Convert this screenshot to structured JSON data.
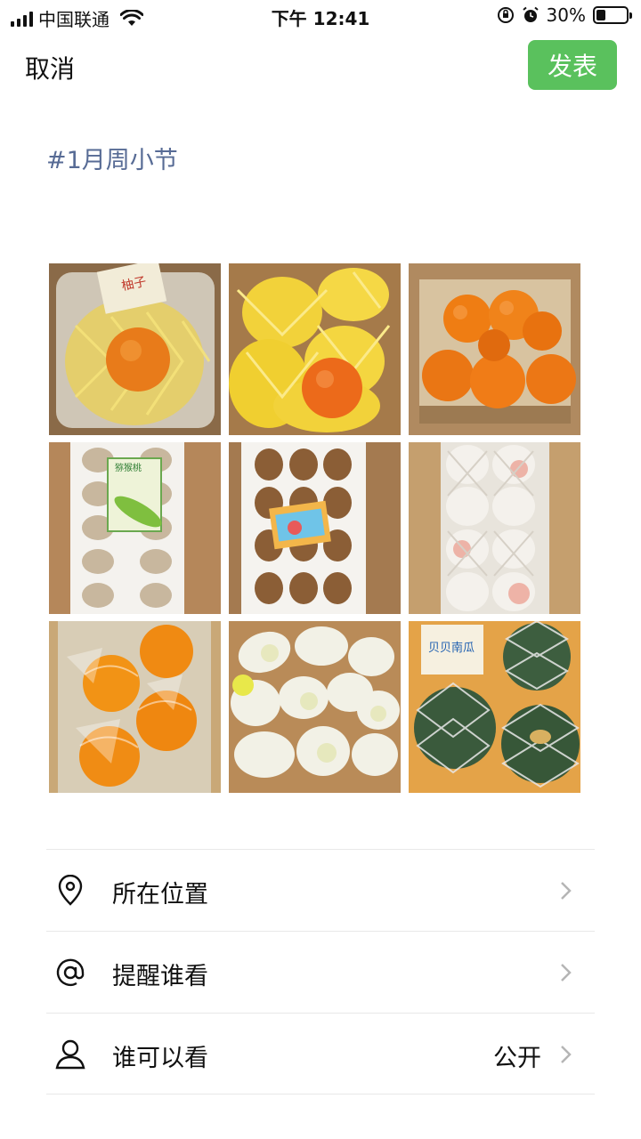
{
  "status_bar": {
    "carrier": "中国联通",
    "time": "下午 12:41",
    "battery": "30%",
    "battery_level": 0.3,
    "icons": [
      "signal-icon",
      "wifi-icon",
      "rotation-lock-icon",
      "alarm-icon",
      "battery-icon"
    ]
  },
  "nav": {
    "cancel_label": "取消",
    "publish_label": "发表",
    "publish_color": "#5ac15d"
  },
  "post": {
    "text": "#1月周小节",
    "text_color": "#576b95"
  },
  "photos": [
    {
      "label": "柚子"
    },
    {
      "label": ""
    },
    {
      "label": ""
    },
    {
      "label": "猕猴桃"
    },
    {
      "label": ""
    },
    {
      "label": ""
    },
    {
      "label": ""
    },
    {
      "label": ""
    },
    {
      "label": "贝贝南瓜"
    }
  ],
  "settings": [
    {
      "label": "所在位置",
      "value": "",
      "icon": "location-icon"
    },
    {
      "label": "提醒谁看",
      "value": "",
      "icon": "at-icon"
    },
    {
      "label": "谁可以看",
      "value": "公开",
      "icon": "person-icon"
    }
  ]
}
